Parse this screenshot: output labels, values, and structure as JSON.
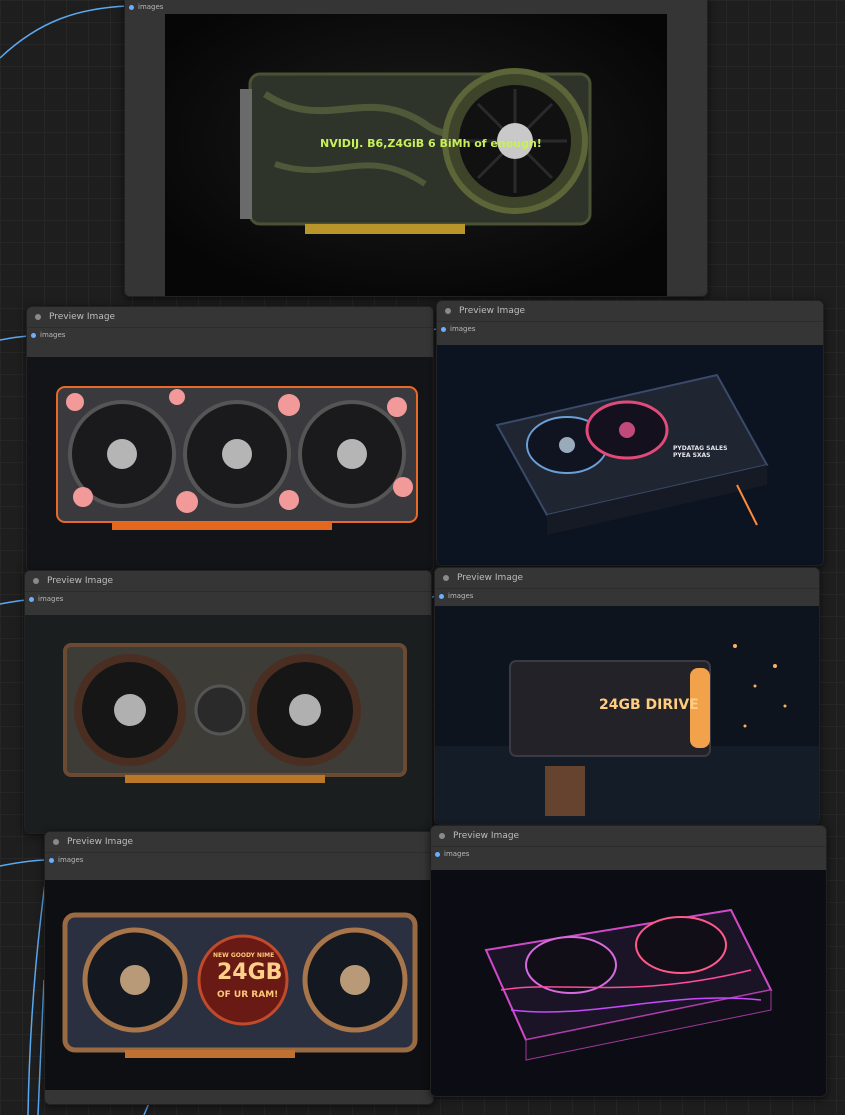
{
  "nodes": [
    {
      "title": "",
      "slot": "images",
      "caption": "NVIDIJ. B6,Z4GiB 6 BiMh of enough!"
    },
    {
      "title": "Preview Image",
      "slot": "images"
    },
    {
      "title": "Preview Image",
      "slot": "images",
      "caption": "PYDATAG SALES PYEA SXAS"
    },
    {
      "title": "Preview Image",
      "slot": "images"
    },
    {
      "title": "Preview Image",
      "slot": "images",
      "caption": "24GB DIRIVE"
    },
    {
      "title": "Preview Image",
      "slot": "images",
      "caption_top": "NEW GOODY NIME",
      "caption_main": "24GB",
      "caption_bottom": "OF UR RAM!"
    },
    {
      "title": "Preview Image",
      "slot": "images"
    }
  ],
  "colors": {
    "link": "#5aa9f0",
    "canvas": "#1e1e1e",
    "node": "#353535"
  }
}
